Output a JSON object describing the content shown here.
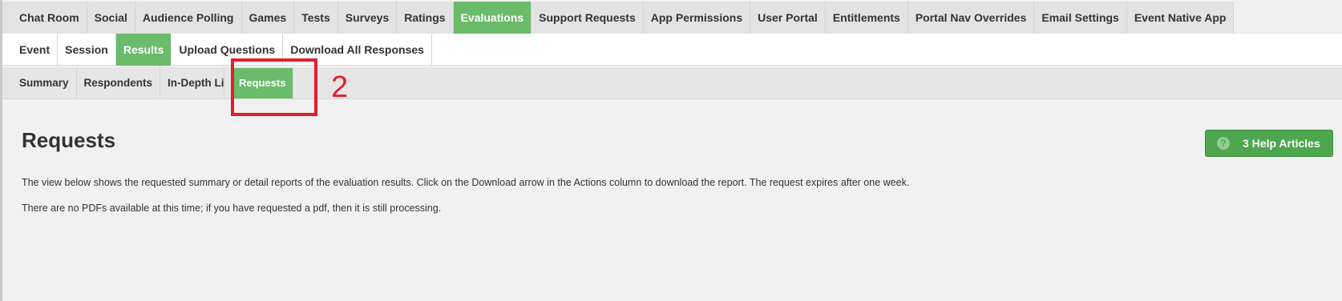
{
  "main_tabs": [
    {
      "label": "Chat Room",
      "active": false
    },
    {
      "label": "Social",
      "active": false
    },
    {
      "label": "Audience Polling",
      "active": false
    },
    {
      "label": "Games",
      "active": false
    },
    {
      "label": "Tests",
      "active": false
    },
    {
      "label": "Surveys",
      "active": false
    },
    {
      "label": "Ratings",
      "active": false
    },
    {
      "label": "Evaluations",
      "active": true
    },
    {
      "label": "Support Requests",
      "active": false
    },
    {
      "label": "App Permissions",
      "active": false
    },
    {
      "label": "User Portal",
      "active": false
    },
    {
      "label": "Entitlements",
      "active": false
    },
    {
      "label": "Portal Nav Overrides",
      "active": false
    },
    {
      "label": "Email Settings",
      "active": false
    },
    {
      "label": "Event Native App",
      "active": false
    }
  ],
  "sub_tabs": [
    {
      "label": "Event",
      "active": false
    },
    {
      "label": "Session",
      "active": false
    },
    {
      "label": "Results",
      "active": true
    },
    {
      "label": "Upload Questions",
      "active": false
    },
    {
      "label": "Download All Responses",
      "active": false
    }
  ],
  "results_tabs": [
    {
      "label": "Summary",
      "active": false
    },
    {
      "label": "Respondents",
      "active": false
    },
    {
      "label": "In-Depth List",
      "active": false
    },
    {
      "label": "Requests",
      "active": true
    }
  ],
  "annotation": {
    "label": "2",
    "color": "#e0202b"
  },
  "content": {
    "title": "Requests",
    "help_button_label": "3 Help Articles",
    "help_icon_glyph": "?",
    "description": "The view below shows the requested summary or detail reports of the evaluation results.  Click on the Download arrow in the Actions column to download the report.  The request expires after one week.",
    "empty_message": "There are no PDFs available at this time; if you have requested a pdf, then it is still processing."
  },
  "colors": {
    "active_tab": "#6abb6a",
    "help_button": "#4ea64e"
  }
}
